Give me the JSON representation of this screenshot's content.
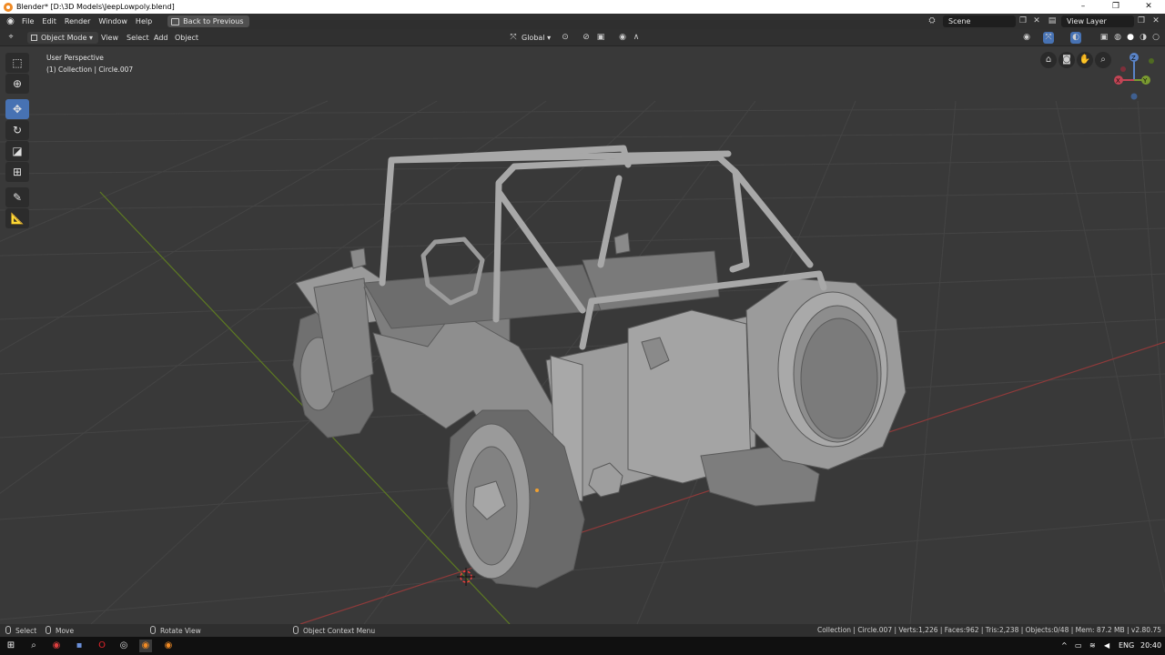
{
  "window": {
    "title": "Blender* [D:\\3D Models\\JeepLowpoly.blend]",
    "controls": [
      "–",
      "❐",
      "✕"
    ]
  },
  "topbar": {
    "menus": [
      "File",
      "Edit",
      "Render",
      "Window",
      "Help"
    ],
    "back_button": "Back to Previous",
    "scene": "Scene",
    "view_layer": "View Layer"
  },
  "viewport_header": {
    "mode": "Object Mode",
    "menus": [
      "View",
      "Select",
      "Add",
      "Object"
    ],
    "transform_orientation": "Global"
  },
  "viewport": {
    "perspective": "User Perspective",
    "collection": "(1) Collection | Circle.007",
    "gizmo_axes": [
      "X",
      "Y",
      "Z"
    ],
    "colors": {
      "background": "#393939",
      "grid": "#444444",
      "x_axis": "#8f3a3a",
      "y_axis": "#5d7a22",
      "mesh": "#8a8a8a",
      "active_tool": "#4772b3"
    }
  },
  "toolbar": {
    "tools": [
      "select-box",
      "cursor",
      "move",
      "rotate",
      "scale",
      "transform",
      "annotate",
      "measure"
    ],
    "active": "move"
  },
  "statusbar": {
    "select": "Select",
    "move": "Move",
    "rotate": "Rotate View",
    "context": "Object Context Menu",
    "stats": "Collection | Circle.007 | Verts:1,226 | Faces:962 | Tris:2,238 | Objects:0/48 | Mem: 87.2 MB | v2.80.75"
  },
  "taskbar": {
    "language": "ENG",
    "time": "20:40"
  }
}
